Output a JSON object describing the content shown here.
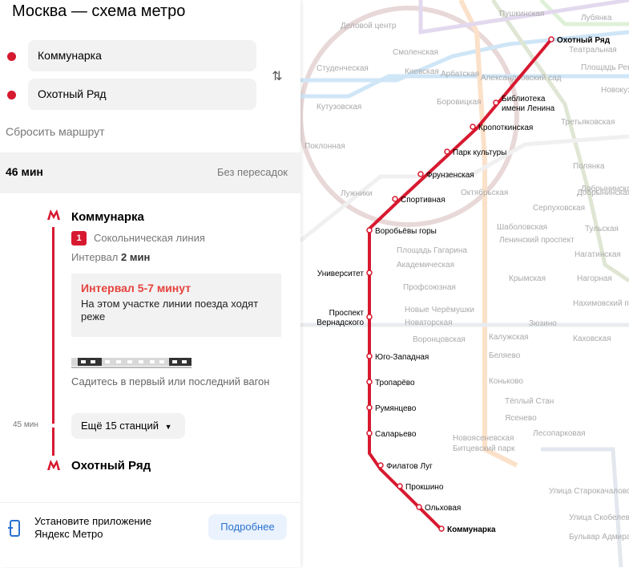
{
  "header": {
    "title": "Москва — схема метро"
  },
  "route": {
    "from": "Коммунарка",
    "to": "Охотный Ряд",
    "reset_label": "Сбросить маршрут",
    "duration": "46 мин",
    "transfers": "Без пересадок"
  },
  "segment": {
    "start_station": "Коммунарка",
    "line_number": "1",
    "line_name": "Сокольническая линия",
    "interval_label": "Интервал",
    "interval_value": "2 мин",
    "warning_title": "Интервал 5-7 минут",
    "warning_text": "На этом участке линии поезда ходят реже",
    "car_hint": "Садитесь в первый или последний вагон",
    "time_mark": "45 мин",
    "more_stations": "Ещё 15 станций",
    "end_station": "Охотный Ряд"
  },
  "app_banner": {
    "text": "Установите приложение Яндекс Метро",
    "button": "Подробнее"
  },
  "map": {
    "route_color": "#d7192f",
    "route_stations": [
      "Охотный Ряд",
      "Библиотека имени Ленина",
      "Кропоткинская",
      "Парк культуры",
      "Фрунзенская",
      "Спортивная",
      "Воробьёвы горы",
      "Университет",
      "Проспект Вернадского",
      "Юго-Западная",
      "Тропарёво",
      "Румянцево",
      "Саларьево",
      "Филатов Луг",
      "Прокшино",
      "Ольховая",
      "Коммунарка"
    ],
    "faded_labels": [
      "Пушкинская",
      "Лубянка",
      "Деловой центр",
      "Театральная",
      "Смоленская",
      "Арбатская",
      "Площадь Революции",
      "Киевская",
      "Александровский сад",
      "Студенческая",
      "Новокузнецкая",
      "Кутузовская",
      "Боровицкая",
      "Третьяковская",
      "Октябрьская",
      "Добрынинская",
      "Серпуховская",
      "Тульская",
      "Шаболовская",
      "Ленинский проспект",
      "Нагатинская",
      "Крымская",
      "Нагорная",
      "Нахимовский проспект",
      "Калужская",
      "Каховская",
      "Беляево",
      "Коньково",
      "Тёплый Стан",
      "Ясенево",
      "Лесопарковая",
      "Новоясеневская",
      "Битцевский парк",
      "Улица Старокачаловская",
      "Улица Скобелевская",
      "Бульвар Адмирала Ушакова",
      "Лужники",
      "Поклонная",
      "Площадь Гагарина",
      "Академическая",
      "Профсоюзная",
      "Новые Черёмушки",
      "Новаторская",
      "Воронцовская",
      "Зюзино",
      "Полянка",
      "Добрынинская"
    ]
  }
}
